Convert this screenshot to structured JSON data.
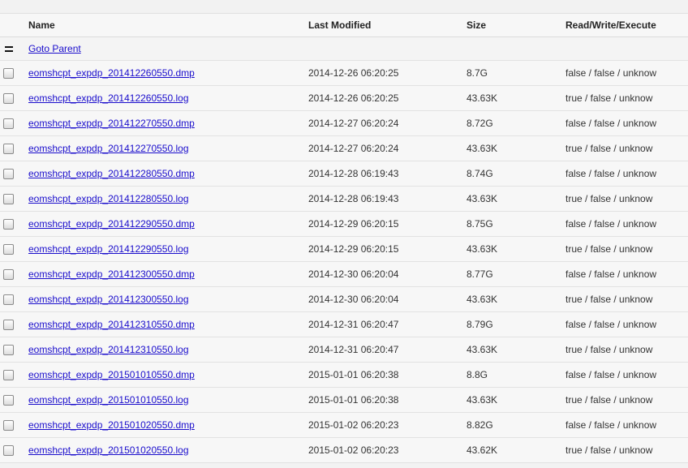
{
  "header": {
    "name": "Name",
    "last_modified": "Last Modified",
    "size": "Size",
    "rwx": "Read/Write/Execute"
  },
  "parent_link": "Goto Parent",
  "files": [
    {
      "name": "eomshcpt_expdp_201412260550.dmp",
      "modified": "2014-12-26 06:20:25",
      "size": "8.7G",
      "rwx": "false / false / unknow"
    },
    {
      "name": "eomshcpt_expdp_201412260550.log",
      "modified": "2014-12-26 06:20:25",
      "size": "43.63K",
      "rwx": "true / false / unknow"
    },
    {
      "name": "eomshcpt_expdp_201412270550.dmp",
      "modified": "2014-12-27 06:20:24",
      "size": "8.72G",
      "rwx": "false / false / unknow"
    },
    {
      "name": "eomshcpt_expdp_201412270550.log",
      "modified": "2014-12-27 06:20:24",
      "size": "43.63K",
      "rwx": "true / false / unknow"
    },
    {
      "name": "eomshcpt_expdp_201412280550.dmp",
      "modified": "2014-12-28 06:19:43",
      "size": "8.74G",
      "rwx": "false / false / unknow"
    },
    {
      "name": "eomshcpt_expdp_201412280550.log",
      "modified": "2014-12-28 06:19:43",
      "size": "43.63K",
      "rwx": "true / false / unknow"
    },
    {
      "name": "eomshcpt_expdp_201412290550.dmp",
      "modified": "2014-12-29 06:20:15",
      "size": "8.75G",
      "rwx": "false / false / unknow"
    },
    {
      "name": "eomshcpt_expdp_201412290550.log",
      "modified": "2014-12-29 06:20:15",
      "size": "43.63K",
      "rwx": "true / false / unknow"
    },
    {
      "name": "eomshcpt_expdp_201412300550.dmp",
      "modified": "2014-12-30 06:20:04",
      "size": "8.77G",
      "rwx": "false / false / unknow"
    },
    {
      "name": "eomshcpt_expdp_201412300550.log",
      "modified": "2014-12-30 06:20:04",
      "size": "43.63K",
      "rwx": "true / false / unknow"
    },
    {
      "name": "eomshcpt_expdp_201412310550.dmp",
      "modified": "2014-12-31 06:20:47",
      "size": "8.79G",
      "rwx": "false / false / unknow"
    },
    {
      "name": "eomshcpt_expdp_201412310550.log",
      "modified": "2014-12-31 06:20:47",
      "size": "43.63K",
      "rwx": "true / false / unknow"
    },
    {
      "name": "eomshcpt_expdp_201501010550.dmp",
      "modified": "2015-01-01 06:20:38",
      "size": "8.8G",
      "rwx": "false / false / unknow"
    },
    {
      "name": "eomshcpt_expdp_201501010550.log",
      "modified": "2015-01-01 06:20:38",
      "size": "43.63K",
      "rwx": "true / false / unknow"
    },
    {
      "name": "eomshcpt_expdp_201501020550.dmp",
      "modified": "2015-01-02 06:20:23",
      "size": "8.82G",
      "rwx": "false / false / unknow"
    },
    {
      "name": "eomshcpt_expdp_201501020550.log",
      "modified": "2015-01-02 06:20:23",
      "size": "43.62K",
      "rwx": "true / false / unknow"
    }
  ],
  "colors": {
    "link": "#1a0dcc",
    "row_bg": "#f7f7f7",
    "border": "#e2e2e2"
  }
}
